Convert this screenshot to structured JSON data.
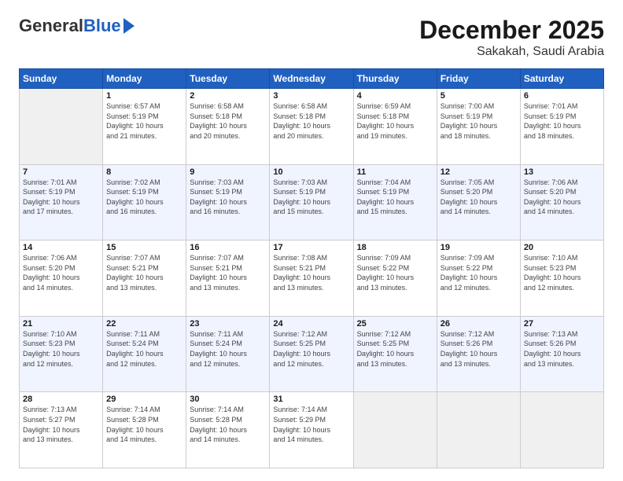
{
  "header": {
    "logo_general": "General",
    "logo_blue": "Blue",
    "month_title": "December 2025",
    "location": "Sakakah, Saudi Arabia"
  },
  "days_of_week": [
    "Sunday",
    "Monday",
    "Tuesday",
    "Wednesday",
    "Thursday",
    "Friday",
    "Saturday"
  ],
  "weeks": [
    [
      {
        "day": "",
        "info": ""
      },
      {
        "day": "1",
        "info": "Sunrise: 6:57 AM\nSunset: 5:19 PM\nDaylight: 10 hours\nand 21 minutes."
      },
      {
        "day": "2",
        "info": "Sunrise: 6:58 AM\nSunset: 5:18 PM\nDaylight: 10 hours\nand 20 minutes."
      },
      {
        "day": "3",
        "info": "Sunrise: 6:58 AM\nSunset: 5:18 PM\nDaylight: 10 hours\nand 20 minutes."
      },
      {
        "day": "4",
        "info": "Sunrise: 6:59 AM\nSunset: 5:18 PM\nDaylight: 10 hours\nand 19 minutes."
      },
      {
        "day": "5",
        "info": "Sunrise: 7:00 AM\nSunset: 5:19 PM\nDaylight: 10 hours\nand 18 minutes."
      },
      {
        "day": "6",
        "info": "Sunrise: 7:01 AM\nSunset: 5:19 PM\nDaylight: 10 hours\nand 18 minutes."
      }
    ],
    [
      {
        "day": "7",
        "info": "Sunrise: 7:01 AM\nSunset: 5:19 PM\nDaylight: 10 hours\nand 17 minutes."
      },
      {
        "day": "8",
        "info": "Sunrise: 7:02 AM\nSunset: 5:19 PM\nDaylight: 10 hours\nand 16 minutes."
      },
      {
        "day": "9",
        "info": "Sunrise: 7:03 AM\nSunset: 5:19 PM\nDaylight: 10 hours\nand 16 minutes."
      },
      {
        "day": "10",
        "info": "Sunrise: 7:03 AM\nSunset: 5:19 PM\nDaylight: 10 hours\nand 15 minutes."
      },
      {
        "day": "11",
        "info": "Sunrise: 7:04 AM\nSunset: 5:19 PM\nDaylight: 10 hours\nand 15 minutes."
      },
      {
        "day": "12",
        "info": "Sunrise: 7:05 AM\nSunset: 5:20 PM\nDaylight: 10 hours\nand 14 minutes."
      },
      {
        "day": "13",
        "info": "Sunrise: 7:06 AM\nSunset: 5:20 PM\nDaylight: 10 hours\nand 14 minutes."
      }
    ],
    [
      {
        "day": "14",
        "info": "Sunrise: 7:06 AM\nSunset: 5:20 PM\nDaylight: 10 hours\nand 14 minutes."
      },
      {
        "day": "15",
        "info": "Sunrise: 7:07 AM\nSunset: 5:21 PM\nDaylight: 10 hours\nand 13 minutes."
      },
      {
        "day": "16",
        "info": "Sunrise: 7:07 AM\nSunset: 5:21 PM\nDaylight: 10 hours\nand 13 minutes."
      },
      {
        "day": "17",
        "info": "Sunrise: 7:08 AM\nSunset: 5:21 PM\nDaylight: 10 hours\nand 13 minutes."
      },
      {
        "day": "18",
        "info": "Sunrise: 7:09 AM\nSunset: 5:22 PM\nDaylight: 10 hours\nand 13 minutes."
      },
      {
        "day": "19",
        "info": "Sunrise: 7:09 AM\nSunset: 5:22 PM\nDaylight: 10 hours\nand 12 minutes."
      },
      {
        "day": "20",
        "info": "Sunrise: 7:10 AM\nSunset: 5:23 PM\nDaylight: 10 hours\nand 12 minutes."
      }
    ],
    [
      {
        "day": "21",
        "info": "Sunrise: 7:10 AM\nSunset: 5:23 PM\nDaylight: 10 hours\nand 12 minutes."
      },
      {
        "day": "22",
        "info": "Sunrise: 7:11 AM\nSunset: 5:24 PM\nDaylight: 10 hours\nand 12 minutes."
      },
      {
        "day": "23",
        "info": "Sunrise: 7:11 AM\nSunset: 5:24 PM\nDaylight: 10 hours\nand 12 minutes."
      },
      {
        "day": "24",
        "info": "Sunrise: 7:12 AM\nSunset: 5:25 PM\nDaylight: 10 hours\nand 12 minutes."
      },
      {
        "day": "25",
        "info": "Sunrise: 7:12 AM\nSunset: 5:25 PM\nDaylight: 10 hours\nand 13 minutes."
      },
      {
        "day": "26",
        "info": "Sunrise: 7:12 AM\nSunset: 5:26 PM\nDaylight: 10 hours\nand 13 minutes."
      },
      {
        "day": "27",
        "info": "Sunrise: 7:13 AM\nSunset: 5:26 PM\nDaylight: 10 hours\nand 13 minutes."
      }
    ],
    [
      {
        "day": "28",
        "info": "Sunrise: 7:13 AM\nSunset: 5:27 PM\nDaylight: 10 hours\nand 13 minutes."
      },
      {
        "day": "29",
        "info": "Sunrise: 7:14 AM\nSunset: 5:28 PM\nDaylight: 10 hours\nand 14 minutes."
      },
      {
        "day": "30",
        "info": "Sunrise: 7:14 AM\nSunset: 5:28 PM\nDaylight: 10 hours\nand 14 minutes."
      },
      {
        "day": "31",
        "info": "Sunrise: 7:14 AM\nSunset: 5:29 PM\nDaylight: 10 hours\nand 14 minutes."
      },
      {
        "day": "",
        "info": ""
      },
      {
        "day": "",
        "info": ""
      },
      {
        "day": "",
        "info": ""
      }
    ]
  ]
}
